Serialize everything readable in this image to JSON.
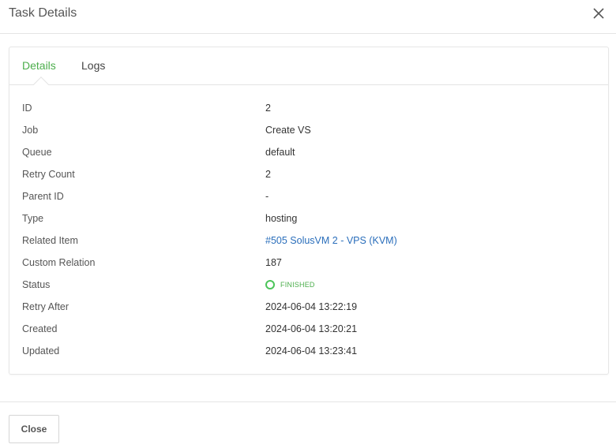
{
  "modal": {
    "title": "Task Details",
    "close_button_label": "Close"
  },
  "tabs": [
    {
      "label": "Details",
      "active": true
    },
    {
      "label": "Logs",
      "active": false
    }
  ],
  "details": {
    "rows": [
      {
        "label": "ID",
        "value": "2"
      },
      {
        "label": "Job",
        "value": "Create VS"
      },
      {
        "label": "Queue",
        "value": "default"
      },
      {
        "label": "Retry Count",
        "value": "2"
      },
      {
        "label": "Parent ID",
        "value": "-"
      },
      {
        "label": "Type",
        "value": "hosting"
      },
      {
        "label": "Related Item",
        "value": "#505 SolusVM 2 - VPS (KVM)"
      },
      {
        "label": "Custom Relation",
        "value": "187"
      },
      {
        "label": "Status",
        "value": "FINISHED"
      },
      {
        "label": "Retry After",
        "value": "2024-06-04 13:22:19"
      },
      {
        "label": "Created",
        "value": "2024-06-04 13:20:21"
      },
      {
        "label": "Updated",
        "value": "2024-06-04 13:23:41"
      }
    ]
  },
  "colors": {
    "active_tab": "#4cae4c",
    "link": "#2a6ebb",
    "status_finished": "#4cc55a"
  },
  "icons": {
    "close": "close-icon",
    "status": "status-circle-icon"
  }
}
